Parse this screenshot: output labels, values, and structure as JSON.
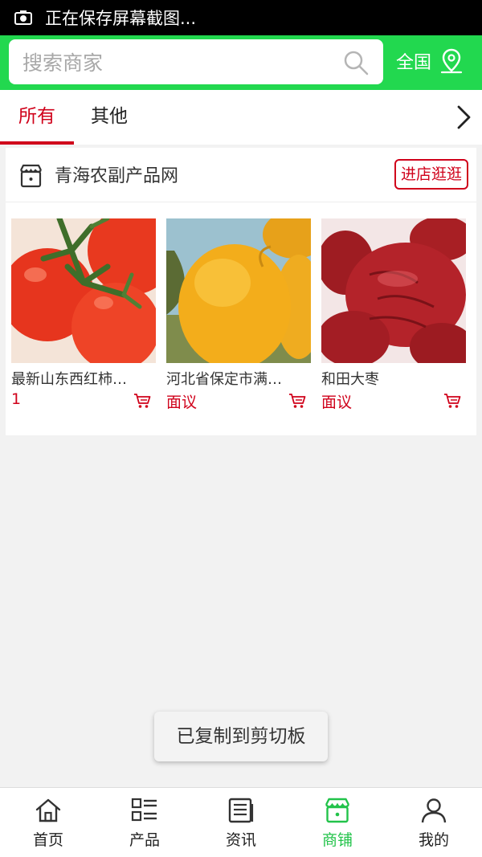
{
  "status_bar": {
    "text": "正在保存屏幕截图..."
  },
  "search": {
    "placeholder": "搜索商家",
    "region_label": "全国"
  },
  "tabs": [
    {
      "label": "所有",
      "active": true
    },
    {
      "label": "其他",
      "active": false
    }
  ],
  "shop": {
    "name": "青海农副产品网",
    "visit_label": "进店逛逛",
    "products": [
      {
        "name": "最新山东西红柿…",
        "price": "1"
      },
      {
        "name": "河北省保定市满…",
        "price": "面议"
      },
      {
        "name": "和田大枣",
        "price": "面议"
      }
    ]
  },
  "toast": {
    "text": "已复制到剪切板"
  },
  "bottom_nav": [
    {
      "label": "首页",
      "icon": "home-icon"
    },
    {
      "label": "产品",
      "icon": "list-icon"
    },
    {
      "label": "资讯",
      "icon": "news-icon"
    },
    {
      "label": "商铺",
      "icon": "store-icon",
      "active": true
    },
    {
      "label": "我的",
      "icon": "user-icon"
    }
  ],
  "colors": {
    "brand_green": "#22d84f",
    "accent_red": "#d0021b",
    "active_nav": "#22c34a"
  }
}
